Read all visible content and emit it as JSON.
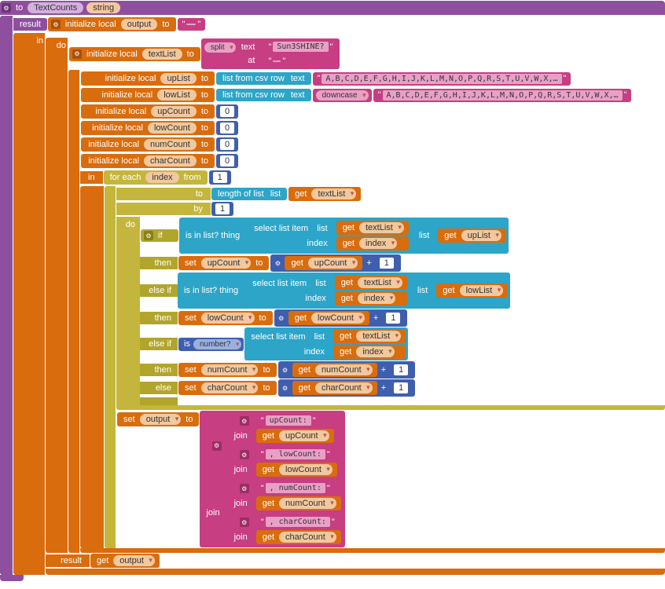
{
  "proc": {
    "to": "to",
    "name": "TextCounts",
    "arg": "string",
    "result": "result"
  },
  "outputInit": {
    "kw": "initialize local",
    "var": "output",
    "to": "to",
    "val": " "
  },
  "in": "in",
  "do": "do",
  "locals": {
    "textList": {
      "kw": "initialize local",
      "var": "textList",
      "to": "to"
    },
    "split": {
      "op": "split",
      "lbl_text": "text",
      "text_val": "Sun3SHINE?",
      "lbl_at": "at",
      "at_val": " "
    },
    "upList": {
      "kw": "initialize local",
      "var": "upList",
      "to": "to",
      "op": "list from csv row",
      "lbl": "text",
      "csv": "A,B,C,D,E,F,G,H,I,J,K,L,M,N,O,P,Q,R,S,T,U,V,W,X,…"
    },
    "lowList": {
      "kw": "initialize local",
      "var": "lowList",
      "to": "to",
      "op": "list from csv row",
      "lbl": "text",
      "downcase": "downcase",
      "csv": "A,B,C,D,E,F,G,H,I,J,K,L,M,N,O,P,Q,R,S,T,U,V,W,X,…"
    },
    "upCount": {
      "kw": "initialize local",
      "var": "upCount",
      "to": "to",
      "val": "0"
    },
    "lowCount": {
      "kw": "initialize local",
      "var": "lowCount",
      "to": "to",
      "val": "0"
    },
    "numCount": {
      "kw": "initialize local",
      "var": "numCount",
      "to": "to",
      "val": "0"
    },
    "charCount": {
      "kw": "initialize local",
      "var": "charCount",
      "to": "to",
      "val": "0"
    }
  },
  "loop": {
    "foreach": "for each",
    "idx": "index",
    "from": "from",
    "from_v": "1",
    "to": "to",
    "len": "length of list",
    "list": "list",
    "get": "get",
    "tl": "textList",
    "by": "by",
    "by_v": "1",
    "do": "do"
  },
  "if": {
    "if": "if",
    "then": "then",
    "elseif": "else if",
    "else": "else",
    "inlist": "is in list? thing",
    "select": "select list item",
    "list": "list",
    "index": "index",
    "get": "get",
    "set": "set",
    "to": "to",
    "textList": "textList",
    "upList": "upList",
    "lowList": "lowList",
    "idx": "index",
    "upCount": "upCount",
    "lowCount": "lowCount",
    "numCount": "numCount",
    "charCount": "charCount",
    "isnum": "is",
    "number": "number?",
    "plus": "+",
    "one": "1"
  },
  "join": {
    "set": "set",
    "output": "output",
    "to": "to",
    "join": "join",
    "l1": "upCount: ",
    "g1": "upCount",
    "l2": ", lowCount: ",
    "g2": "lowCount",
    "l3": ", numCount: ",
    "g3": "numCount",
    "l4": ", charCount: ",
    "g4": "charCount",
    "get": "get"
  },
  "final": {
    "result": "result",
    "get": "get",
    "output": "output"
  }
}
